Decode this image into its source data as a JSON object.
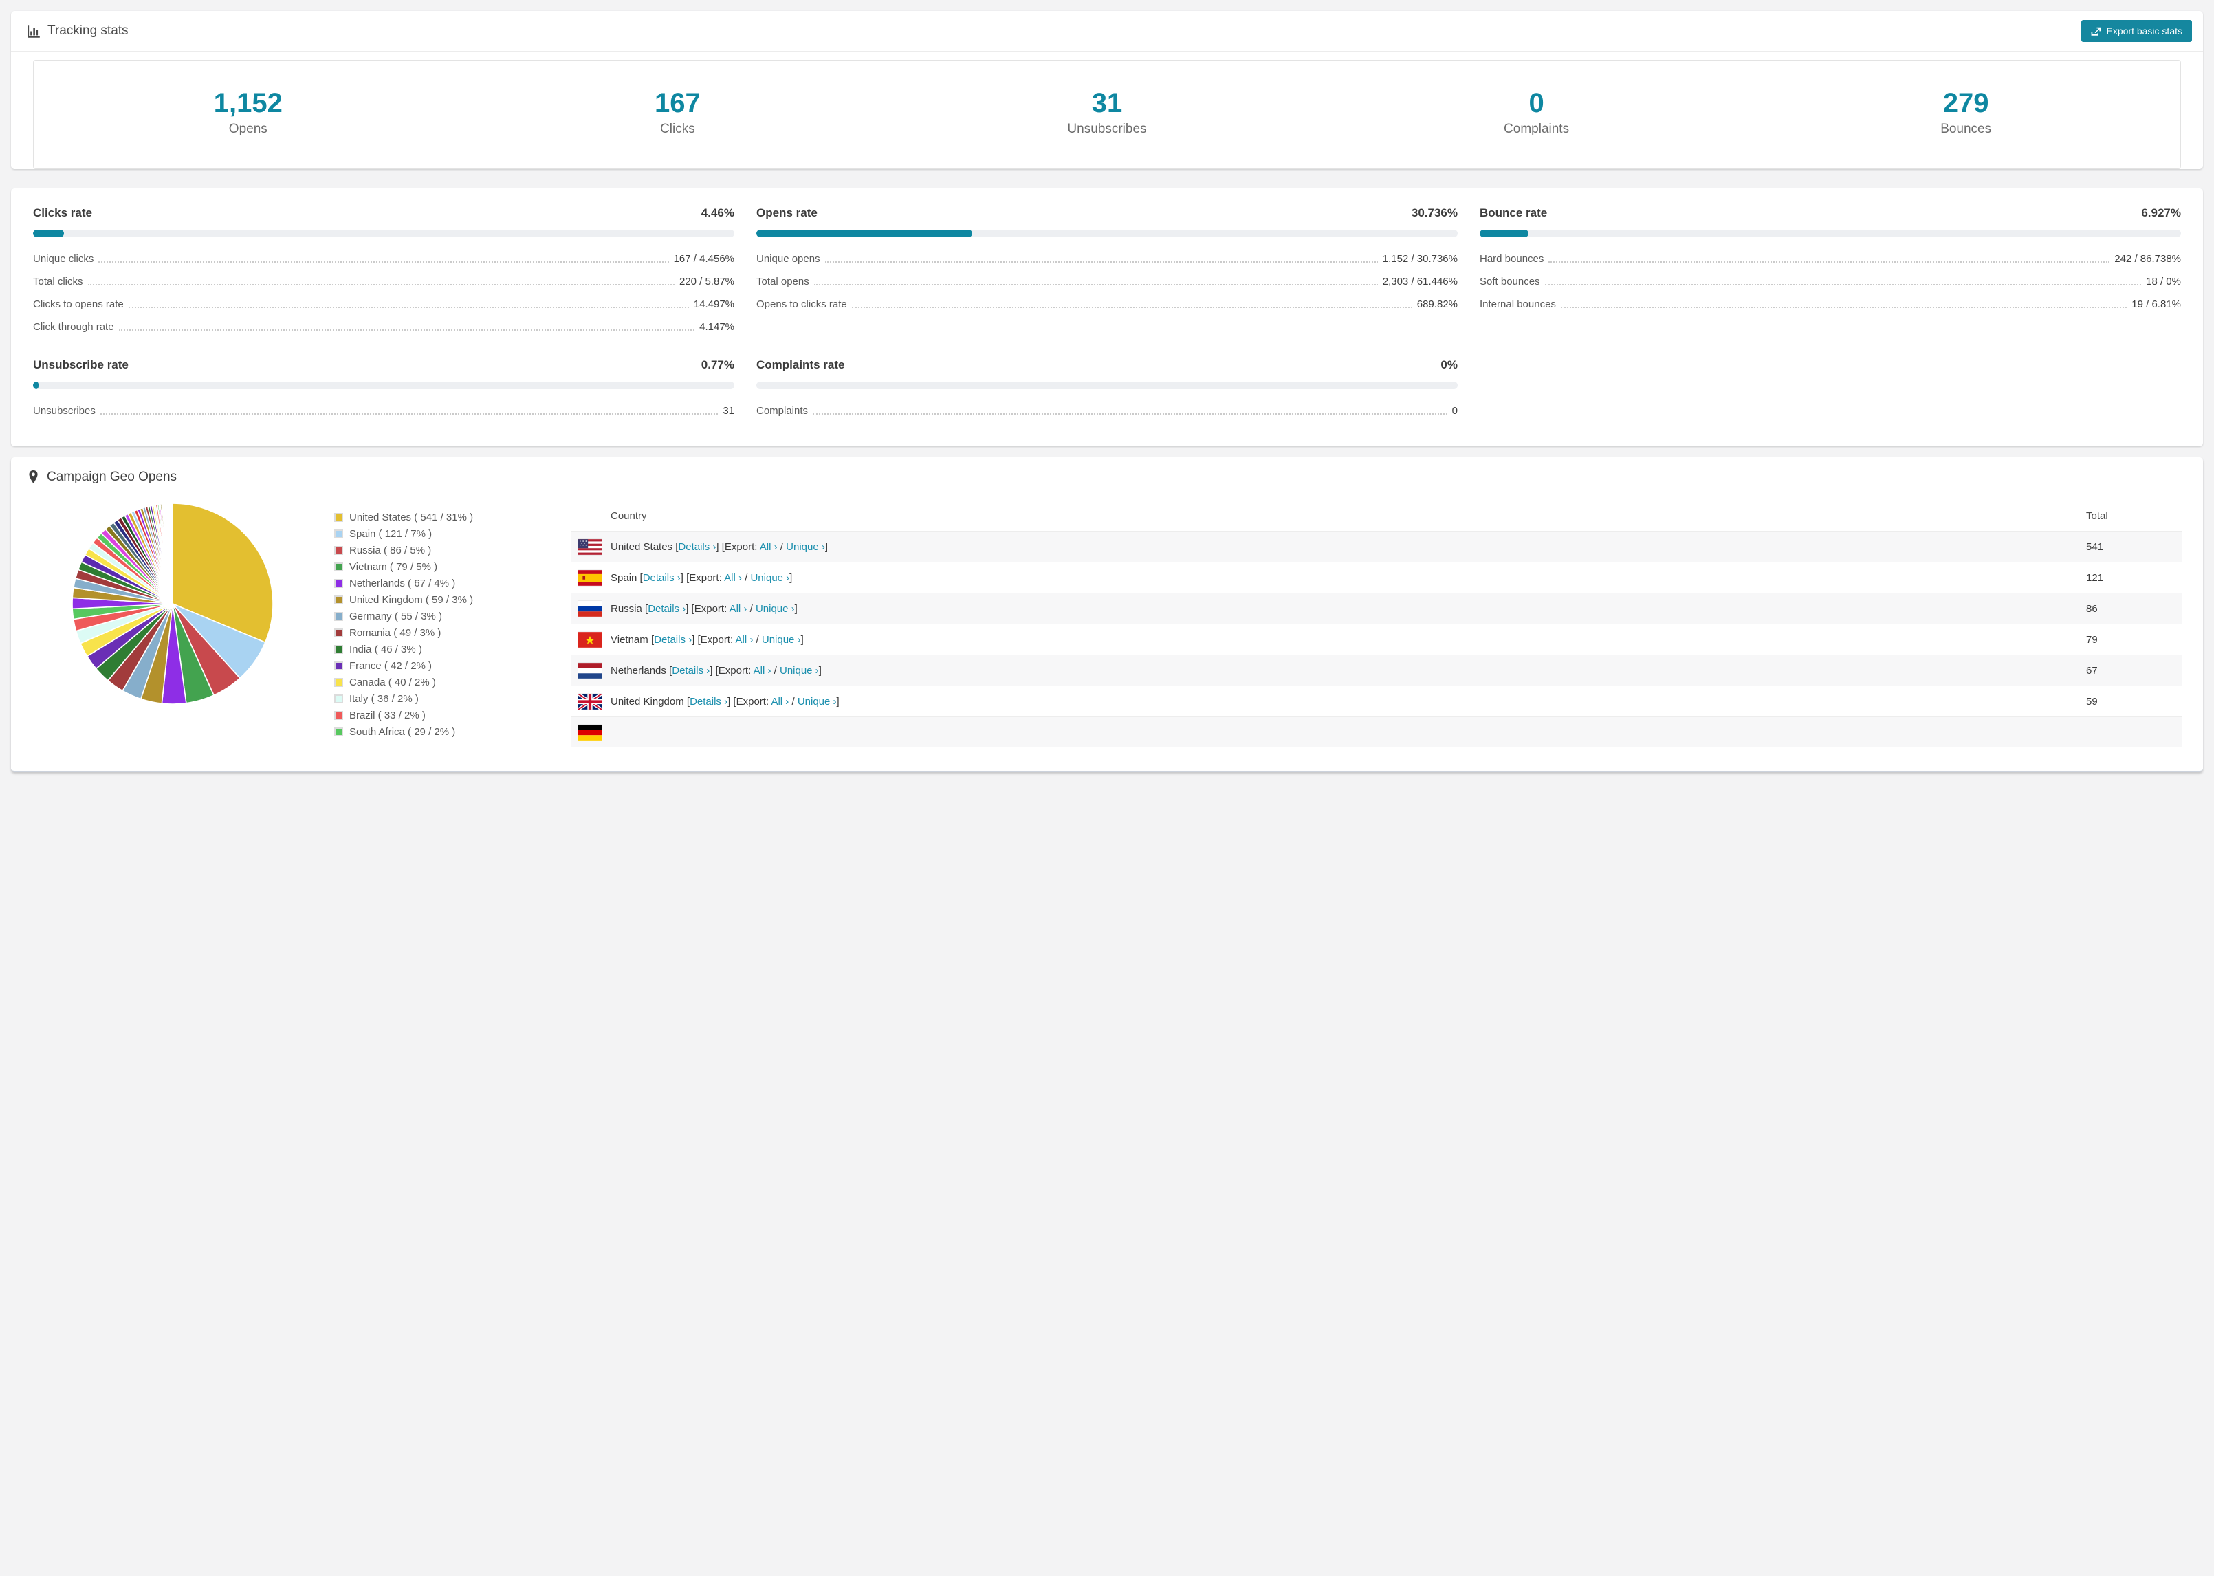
{
  "colors": {
    "accent": "#0e87a1",
    "link": "#1b8fae",
    "bar_track": "#edeff2",
    "row_alt": "#f7f7f8"
  },
  "tracking": {
    "title": "Tracking stats",
    "export_button": "Export basic stats",
    "stats": [
      {
        "value": "1,152",
        "label": "Opens"
      },
      {
        "value": "167",
        "label": "Clicks"
      },
      {
        "value": "31",
        "label": "Unsubscribes"
      },
      {
        "value": "0",
        "label": "Complaints"
      },
      {
        "value": "279",
        "label": "Bounces"
      }
    ]
  },
  "rates": [
    {
      "title": "Clicks rate",
      "value": "4.46%",
      "fill_pct": 4.46,
      "rows": [
        {
          "label": "Unique clicks",
          "value": "167 / 4.456%"
        },
        {
          "label": "Total clicks",
          "value": "220 / 5.87%"
        },
        {
          "label": "Clicks to opens rate",
          "value": "14.497%"
        },
        {
          "label": "Click through rate",
          "value": "4.147%"
        }
      ]
    },
    {
      "title": "Opens rate",
      "value": "30.736%",
      "fill_pct": 30.736,
      "rows": [
        {
          "label": "Unique opens",
          "value": "1,152 / 30.736%"
        },
        {
          "label": "Total opens",
          "value": "2,303 / 61.446%"
        },
        {
          "label": "Opens to clicks rate",
          "value": "689.82%"
        }
      ]
    },
    {
      "title": "Bounce rate",
      "value": "6.927%",
      "fill_pct": 6.927,
      "rows": [
        {
          "label": "Hard bounces",
          "value": "242 / 86.738%"
        },
        {
          "label": "Soft bounces",
          "value": "18 / 0%"
        },
        {
          "label": "Internal bounces",
          "value": "19 / 6.81%"
        }
      ]
    },
    {
      "title": "Unsubscribe rate",
      "value": "0.77%",
      "fill_pct": 0.77,
      "rows": [
        {
          "label": "Unsubscribes",
          "value": "31"
        }
      ]
    },
    {
      "title": "Complaints rate",
      "value": "0%",
      "fill_pct": 0,
      "rows": [
        {
          "label": "Complaints",
          "value": "0"
        }
      ]
    }
  ],
  "geo": {
    "title": "Campaign Geo Opens",
    "table": {
      "country_header": "Country",
      "total_header": "Total",
      "export_word": "Export:",
      "links": {
        "details": "Details ›",
        "all": "All ›",
        "unique": "Unique ›"
      },
      "rows": [
        {
          "flag": "us",
          "country": "United States",
          "total": "541",
          "clipped": false
        },
        {
          "flag": "es",
          "country": "Spain",
          "total": "121",
          "clipped": false
        },
        {
          "flag": "ru",
          "country": "Russia",
          "total": "86",
          "clipped": false
        },
        {
          "flag": "vn",
          "country": "Vietnam",
          "total": "79",
          "clipped": false
        },
        {
          "flag": "nl",
          "country": "Netherlands",
          "total": "67",
          "clipped": false
        },
        {
          "flag": "gb",
          "country": "United Kingdom",
          "total": "59",
          "clipped": false
        },
        {
          "flag": "de",
          "country": "",
          "total": "",
          "clipped": true
        }
      ]
    }
  },
  "chart_data": {
    "type": "pie",
    "title": "Campaign Geo Opens",
    "legend_position": "right",
    "slices": [
      {
        "label": "United States",
        "value": 541,
        "pct": "31%",
        "color": "#e3bf30"
      },
      {
        "label": "Spain",
        "value": 121,
        "pct": "7%",
        "color": "#a9d3f2"
      },
      {
        "label": "Russia",
        "value": 86,
        "pct": "5%",
        "color": "#c8494d"
      },
      {
        "label": "Vietnam",
        "value": 79,
        "pct": "5%",
        "color": "#43a34f"
      },
      {
        "label": "Netherlands",
        "value": 67,
        "pct": "4%",
        "color": "#8e2ee6"
      },
      {
        "label": "United Kingdom",
        "value": 59,
        "pct": "3%",
        "color": "#b3912c"
      },
      {
        "label": "Germany",
        "value": 55,
        "pct": "3%",
        "color": "#86aecb"
      },
      {
        "label": "Romania",
        "value": 49,
        "pct": "3%",
        "color": "#a23c3c"
      },
      {
        "label": "India",
        "value": 46,
        "pct": "3%",
        "color": "#2f7d33"
      },
      {
        "label": "France",
        "value": 42,
        "pct": "2%",
        "color": "#6a2fb5"
      },
      {
        "label": "Canada",
        "value": 40,
        "pct": "2%",
        "color": "#f8e34b"
      },
      {
        "label": "Italy",
        "value": 36,
        "pct": "2%",
        "color": "#dcfbf5"
      },
      {
        "label": "Brazil",
        "value": 33,
        "pct": "2%",
        "color": "#ef5a5a"
      },
      {
        "label": "South Africa",
        "value": 29,
        "pct": "2%",
        "color": "#57c85f"
      }
    ],
    "other_segments": [
      30,
      28,
      26,
      25,
      23,
      22,
      20,
      19,
      18,
      17,
      16,
      15,
      14,
      13,
      12,
      11,
      10,
      10,
      9,
      9,
      8,
      8,
      7,
      7,
      6,
      6,
      5,
      5,
      5,
      4,
      4,
      4,
      3,
      3,
      3,
      3,
      2,
      2,
      2,
      2,
      2,
      1,
      1,
      1,
      1,
      1,
      1,
      0.8,
      0.6,
      0.5
    ],
    "other_palette": [
      "#8e2ee6",
      "#b3912c",
      "#86aecb",
      "#a23c3c",
      "#2f7d33",
      "#5b2ab0",
      "#f8e34b",
      "#dcfbf5",
      "#ef5a5a",
      "#57c85f",
      "#d944e0",
      "#8a7a1f",
      "#4f6d7a",
      "#2b2e83",
      "#7a1f2b",
      "#1e5b2a",
      "#bb44f0",
      "#d4aa2a",
      "#a9d3f2",
      "#e03535"
    ]
  }
}
